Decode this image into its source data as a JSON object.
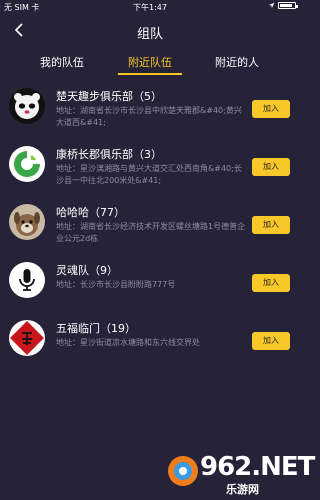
{
  "status_bar": {
    "carrier": "无 SIM 卡",
    "time": "下午1:47",
    "battery_level": 0.85
  },
  "header": {
    "title": "组队"
  },
  "tabs": [
    {
      "label": "我的队伍",
      "active": false
    },
    {
      "label": "附近队伍",
      "active": true
    },
    {
      "label": "附近的人",
      "active": false
    }
  ],
  "teams": [
    {
      "name": "楚天趣步俱乐部（5）",
      "address": "地址：湖南省长沙市长沙县中欣楚天雅郡&#40;黄兴大道西&#41;",
      "join_label": "加入"
    },
    {
      "name": "康桥长郡俱乐部（3）",
      "address": "地址：星沙漓湘路与黄兴大道交汇处西南角&#40;长沙县一中往北200米处&#41;",
      "join_label": "加入"
    },
    {
      "name": "哈哈哈（77）",
      "address": "地址：湖南省长沙经济技术开发区螺丝塘路1号德普企业公元2d栋",
      "join_label": "加入"
    },
    {
      "name": "灵魂队（9）",
      "address": "地址：长沙市长沙县盼盼路777号",
      "join_label": "加入"
    },
    {
      "name": "五福临门（19）",
      "address": "地址：星沙街道凉水塘路和东六线交界处",
      "join_label": "加入"
    }
  ],
  "watermark": {
    "brand": "962.NET",
    "sub": "乐游网"
  },
  "colors": {
    "background": "#262338",
    "accent": "#f7c626",
    "address": "#8d8aa5"
  }
}
